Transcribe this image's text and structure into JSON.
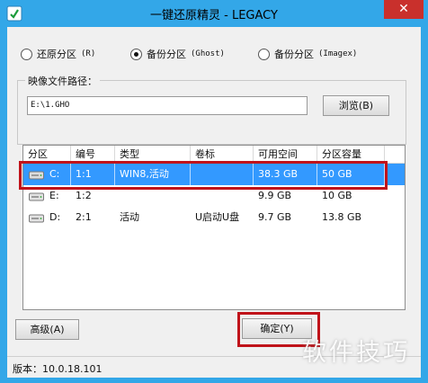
{
  "window": {
    "title": "一键还原精灵 - LEGACY",
    "close_label": "✕",
    "accent_color": "#33a7e8"
  },
  "mode_options": [
    {
      "label": "还原分区",
      "hotkey": "(R)",
      "checked": false
    },
    {
      "label": "备份分区",
      "hotkey": "(Ghost)",
      "checked": true
    },
    {
      "label": "备份分区",
      "hotkey": "(Imagex)",
      "checked": false
    }
  ],
  "image_path": {
    "group_label": "映像文件路径：",
    "value": "E:\\1.GHO",
    "browse_label": "浏览(B)"
  },
  "partition_table": {
    "columns": [
      "分区",
      "编号",
      "类型",
      "卷标",
      "可用空间",
      "分区容量"
    ],
    "rows": [
      {
        "icon": "drive-icon",
        "drive": "C:",
        "number": "1:1",
        "type": "WIN8,活动",
        "label": "",
        "free": "38.3 GB",
        "size": "50 GB",
        "selected": true
      },
      {
        "icon": "drive-icon",
        "drive": "E:",
        "number": "1:2",
        "type": "",
        "label": "",
        "free": "9.9 GB",
        "size": "10 GB",
        "selected": false
      },
      {
        "icon": "drive-icon",
        "drive": "D:",
        "number": "2:1",
        "type": "活动",
        "label": "U启动U盘",
        "free": "9.7 GB",
        "size": "13.8 GB",
        "selected": false
      }
    ],
    "highlight_color": "#c0131a",
    "selected_color": "#3399ff"
  },
  "buttons": {
    "advanced_label": "高级(A)",
    "ok_label": "确定(Y)"
  },
  "status": {
    "version": "版本：10.0.18.101"
  },
  "watermark": "软件技巧"
}
